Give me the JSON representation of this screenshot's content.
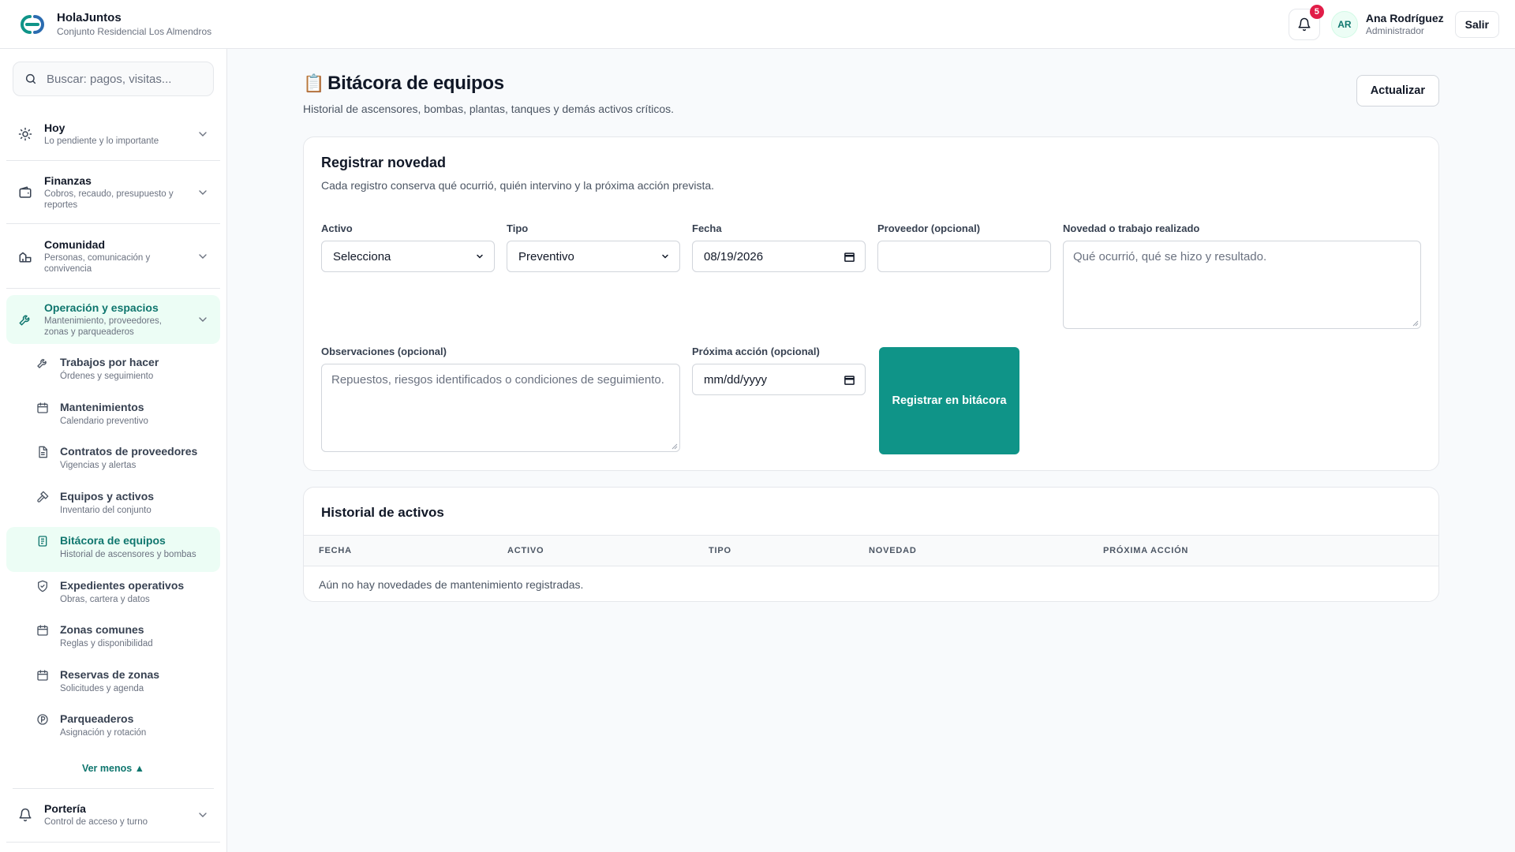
{
  "header": {
    "app_name": "HolaJuntos",
    "community": "Conjunto Residencial Los Almendros",
    "notifications_count": "5",
    "user_initials": "AR",
    "user_name": "Ana Rodríguez",
    "user_role": "Administrador",
    "logout_label": "Salir"
  },
  "sidebar": {
    "search_placeholder": "Buscar: pagos, visitas...",
    "groups": [
      {
        "title": "Hoy",
        "subtitle": "Lo pendiente y lo importante"
      },
      {
        "title": "Finanzas",
        "subtitle": "Cobros, recaudo, presupuesto y reportes"
      },
      {
        "title": "Comunidad",
        "subtitle": "Personas, comunicación y convivencia"
      },
      {
        "title": "Operación y espacios",
        "subtitle": "Mantenimiento, proveedores, zonas y parqueaderos"
      },
      {
        "title": "Portería",
        "subtitle": "Control de acceso y turno"
      }
    ],
    "items": [
      {
        "title": "Trabajos por hacer",
        "subtitle": "Órdenes y seguimiento"
      },
      {
        "title": "Mantenimientos",
        "subtitle": "Calendario preventivo"
      },
      {
        "title": "Contratos de proveedores",
        "subtitle": "Vigencias y alertas"
      },
      {
        "title": "Equipos y activos",
        "subtitle": "Inventario del conjunto"
      },
      {
        "title": "Bitácora de equipos",
        "subtitle": "Historial de ascensores y bombas"
      },
      {
        "title": "Expedientes operativos",
        "subtitle": "Obras, cartera y datos"
      },
      {
        "title": "Zonas comunes",
        "subtitle": "Reglas y disponibilidad"
      },
      {
        "title": "Reservas de zonas",
        "subtitle": "Solicitudes y agenda"
      },
      {
        "title": "Parqueaderos",
        "subtitle": "Asignación y rotación"
      }
    ],
    "see_less": "Ver menos ▲"
  },
  "page": {
    "icon": "📋",
    "title": "Bitácora de equipos",
    "description": "Historial de ascensores, bombas, plantas, tanques y demás activos críticos.",
    "refresh_label": "Actualizar"
  },
  "form": {
    "title": "Registrar novedad",
    "description": "Cada registro conserva qué ocurrió, quién intervino y la próxima acción prevista.",
    "asset_label": "Activo",
    "asset_value": "Selecciona",
    "type_label": "Tipo",
    "type_value": "Preventivo",
    "date_label": "Fecha",
    "date_value": "08/19/2026",
    "provider_label": "Proveedor (opcional)",
    "provider_value": "",
    "work_label": "Novedad o trabajo realizado",
    "work_placeholder": "Qué ocurrió, qué se hizo y resultado.",
    "notes_label": "Observaciones (opcional)",
    "notes_placeholder": "Repuestos, riesgos identificados o condiciones de seguimiento.",
    "next_label": "Próxima acción (opcional)",
    "next_value": "mm/dd/yyyy",
    "submit_label": "Registrar en bitácora"
  },
  "history": {
    "title": "Historial de activos",
    "columns": [
      "FECHA",
      "ACTIVO",
      "TIPO",
      "NOVEDAD",
      "PRÓXIMA ACCIÓN"
    ],
    "empty": "Aún no hay novedades de mantenimiento registradas."
  },
  "colors": {
    "accent": "#0f9488",
    "accent_text": "#0f766e",
    "badge": "#e11d48"
  }
}
